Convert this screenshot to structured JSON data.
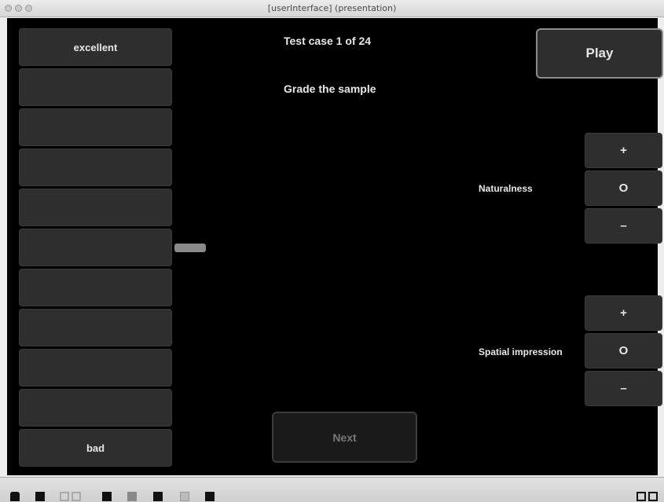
{
  "window": {
    "title": "[userInterface] (presentation)"
  },
  "grades": {
    "top_label": "excellent",
    "bottom_label": "bad"
  },
  "header": {
    "test_case": "Test case 1 of 24",
    "instruction": "Grade the sample"
  },
  "controls": {
    "play_label": "Play",
    "next_label": "Next"
  },
  "attributes": [
    {
      "label": "Naturalness",
      "plus": "+",
      "neutral": "O",
      "minus": "–"
    },
    {
      "label": "Spatial impression",
      "plus": "+",
      "neutral": "O",
      "minus": "–"
    }
  ],
  "colors": {
    "background": "#000000",
    "button": "#2e2e2e",
    "text": "#e8e8e8",
    "disabled_text": "#777777"
  }
}
